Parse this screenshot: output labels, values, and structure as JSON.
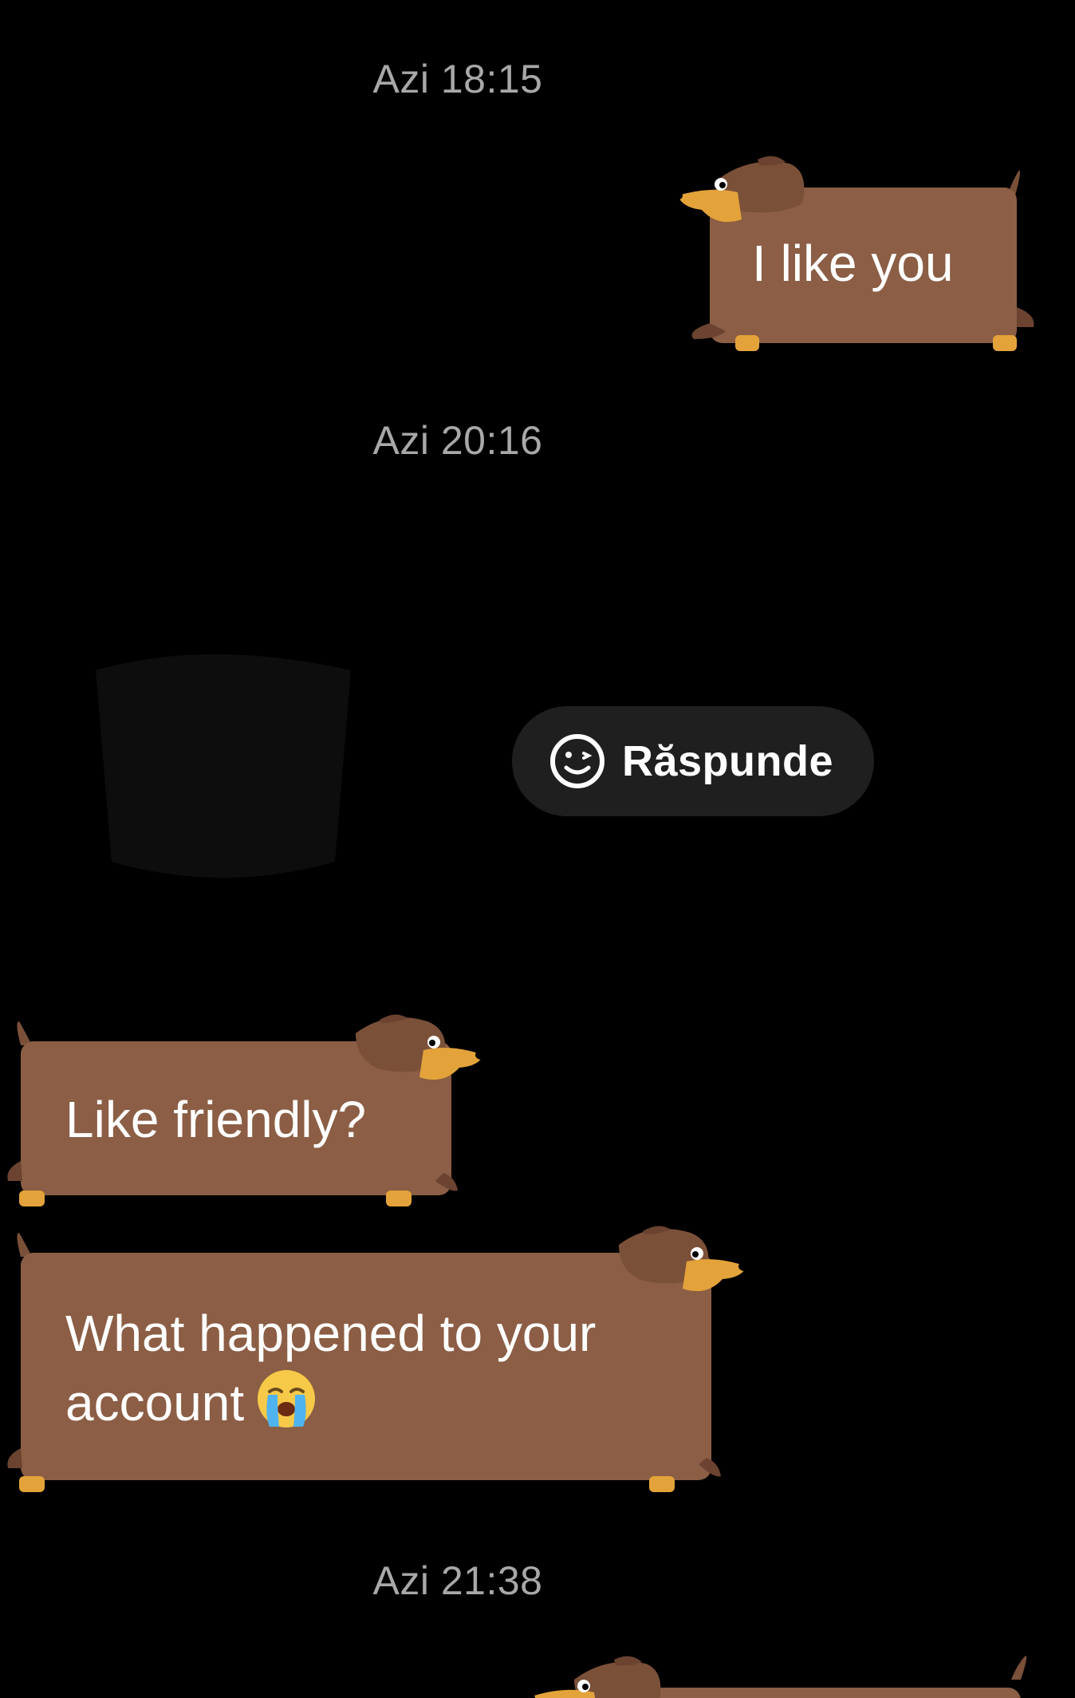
{
  "conversation": {
    "timestamps": [
      "Azi 18:15",
      "Azi 20:16",
      "Azi 21:38"
    ],
    "messages": [
      {
        "side": "right",
        "text": "I like you"
      },
      {
        "side": "left",
        "text": "Like friendly?"
      },
      {
        "side": "left",
        "line1": "What happened to your",
        "line2": "account",
        "emoji": "loudly-crying-face"
      }
    ],
    "reply_button": {
      "label": "Răspunde",
      "icon": "wink-smile-icon"
    }
  },
  "colors": {
    "background": "#000000",
    "bubble": "#8b5e45",
    "dog_head": "#7b5039",
    "dog_ear": "#6b4330",
    "dog_muzzle": "#e3a33a",
    "paws": "#e3a33a",
    "timestamp": "#a8a8a8",
    "pill": "#1f1f1f"
  }
}
